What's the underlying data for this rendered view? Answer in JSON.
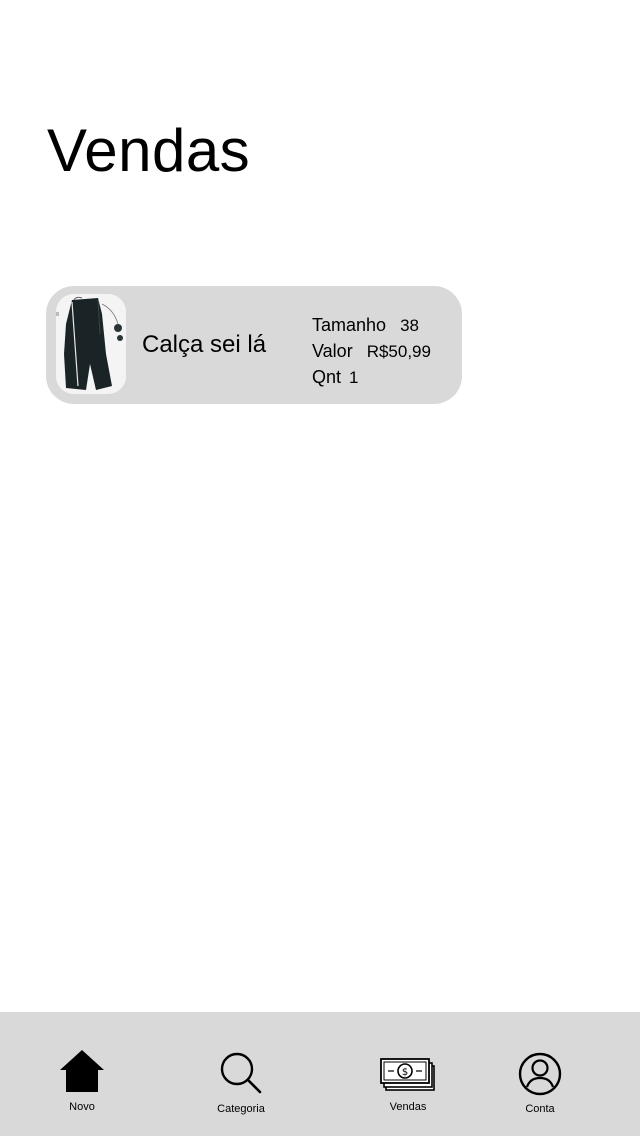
{
  "page": {
    "title": "Vendas"
  },
  "sales": [
    {
      "product_name": "Calça sei lá",
      "size_label": "Tamanho",
      "size_value": "38",
      "price_label": "Valor",
      "price_value": "R$50,99",
      "quantity_label": "Qnt",
      "quantity_value": "1"
    }
  ],
  "tab_bar": {
    "items": [
      {
        "label": "Novo",
        "icon": "home-icon"
      },
      {
        "label": "Categoria",
        "icon": "search-icon"
      },
      {
        "label": "Vendas",
        "icon": "money-stack-icon"
      },
      {
        "label": "Conta",
        "icon": "account-icon"
      }
    ]
  },
  "colors": {
    "background": "#ffffff",
    "card_background": "#d9d9d9",
    "tab_bar_background": "#d9d9d9",
    "text": "#000000"
  }
}
